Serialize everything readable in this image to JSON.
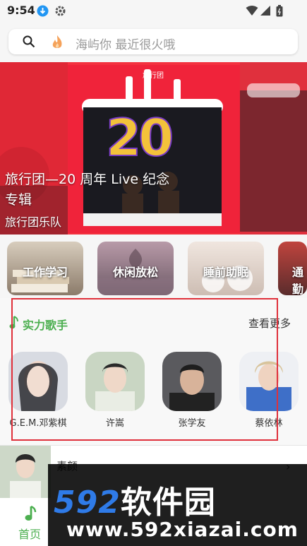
{
  "status_bar": {
    "time": "9:54",
    "icons": [
      "download-icon",
      "gear-icon",
      "wifi-icon",
      "signal-icon",
      "battery-icon"
    ]
  },
  "search": {
    "placeholder": "海屿你 最近很火哦",
    "icons": [
      "search-icon",
      "flame-icon"
    ]
  },
  "banner": {
    "title": "旅行团—20 周年 Live 纪念专辑",
    "artist": "旅行团乐队",
    "cover_text": "旅行团"
  },
  "categories": [
    {
      "label": "工作学习"
    },
    {
      "label": "休闲放松"
    },
    {
      "label": "睡前助眠"
    },
    {
      "label": "通勤"
    }
  ],
  "singers_section": {
    "title": "实力歌手",
    "more": "查看更多",
    "items": [
      {
        "name": "G.E.M.邓紫棋"
      },
      {
        "name": "许嵩"
      },
      {
        "name": "张学友"
      },
      {
        "name": "蔡依林"
      }
    ]
  },
  "mini_player": {
    "song": "素颜"
  },
  "tab_bar": {
    "items": [
      {
        "label": "首页",
        "active": true
      }
    ]
  },
  "watermark": {
    "line1_digits": "592",
    "line1_text": "软件园",
    "line2": "www.592xiazai.com"
  },
  "colors": {
    "accent": "#4caf50",
    "banner_red": "#f3313f",
    "highlight_box": "#e0303b"
  }
}
